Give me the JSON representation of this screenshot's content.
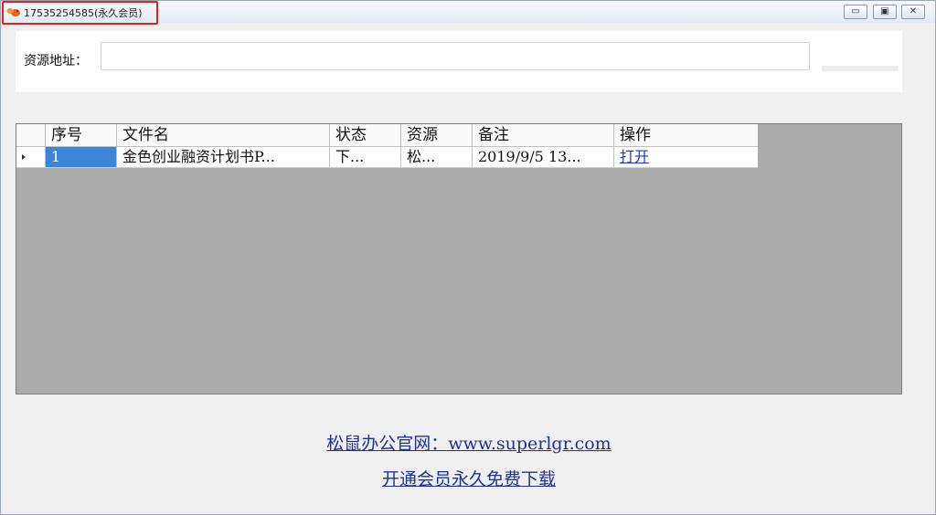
{
  "window": {
    "title": "17535254585(永久会员)",
    "controls": {
      "minimize": "▭",
      "maximize": "▣",
      "close": "✕"
    }
  },
  "source": {
    "label": "资源地址：",
    "value": "",
    "placeholder": ""
  },
  "table": {
    "columns": [
      "序号",
      "文件名",
      "状态",
      "资源",
      "备注",
      "操作"
    ],
    "rows": [
      {
        "seq": "1",
        "filename": "金色创业融资计划书P...",
        "status": "下...",
        "resource": "松...",
        "note": "2019/9/5 13...",
        "action": "打开"
      }
    ]
  },
  "footer": {
    "site_link": "松鼠办公官网：www.superlgr.com",
    "vip_link": "开通会员永久免费下载"
  },
  "colors": {
    "title_highlight": "#e0211c",
    "selection": "#3a86d8",
    "grid_background": "#ababab",
    "link": "#1f2ea3"
  },
  "icons": {
    "app": "squirrel-logo-icon"
  }
}
